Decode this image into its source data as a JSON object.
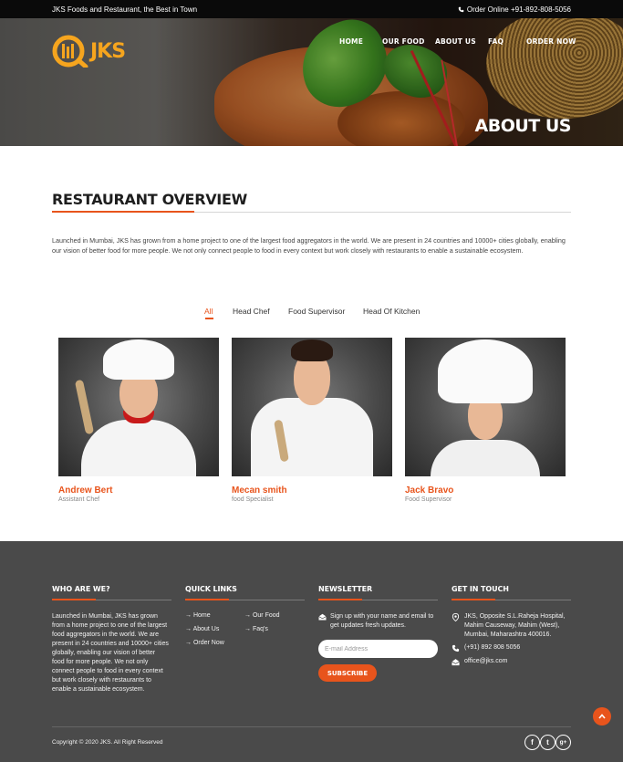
{
  "topbar": {
    "tagline": "JKS Foods and Restaurant, the Best in Town",
    "order_text": "Order Online +91-892-808-5056"
  },
  "brand": {
    "logo_text": "JKS",
    "accent": "#e8541c",
    "logo_color": "#f6a51e"
  },
  "nav": {
    "items": [
      "HOME",
      "OUR FOOD",
      "ABOUT US",
      "FAQ",
      "ORDER NOW"
    ]
  },
  "hero": {
    "title": "ABOUT US"
  },
  "overview": {
    "title": "RESTAURANT OVERVIEW",
    "text": "Launched in Mumbai, JKS has grown from a home project to one of the largest food aggregators in the world. We are present in 24 countries and 10000+ cities globally, enabling our vision of better food for more people. We not only connect people to food in every context but work closely with restaurants to enable a sustainable ecosystem."
  },
  "filters": {
    "items": [
      "All",
      "Head Chef",
      "Food Supervisor",
      "Head Of Kitchen"
    ],
    "active": "All"
  },
  "team": [
    {
      "name": "Andrew Bert",
      "role": "Assistant Chef"
    },
    {
      "name": "Mecan smith",
      "role": "food Specialist"
    },
    {
      "name": "Jack Bravo",
      "role": "Food Supervisor"
    }
  ],
  "footer": {
    "about": {
      "heading": "WHO ARE WE?",
      "text": "Launched in Mumbai, JKS has grown from a home project to one of the largest food aggregators in the world. We are present in 24 countries and 10000+ cities globally, enabling our vision of better food for more people. We not only connect people to food in every context but work closely with restaurants to enable a sustainable ecosystem."
    },
    "quick_links": {
      "heading": "QUICK LINKS",
      "items": [
        "Home",
        "Our Food",
        "About Us",
        "Faq's",
        "Order Now"
      ]
    },
    "newsletter": {
      "heading": "NEWSLETTER",
      "text": "Sign up with your name and email to get updates fresh updates.",
      "placeholder": "E-mail Address",
      "button": "SUBSCRIBE"
    },
    "contact": {
      "heading": "GET IN TOUCH",
      "address": "JKS, Opposite S.L.Raheja Hospital, Mahim Causeway, Mahim (West), Mumbai, Maharashtra 400016.",
      "phone": "(+91) 892 808 5056",
      "email": "office@jks.com"
    },
    "copyright": "Copyright © 2020 JKS. All Right Reserved",
    "social": [
      "f",
      "t",
      "g+"
    ]
  }
}
